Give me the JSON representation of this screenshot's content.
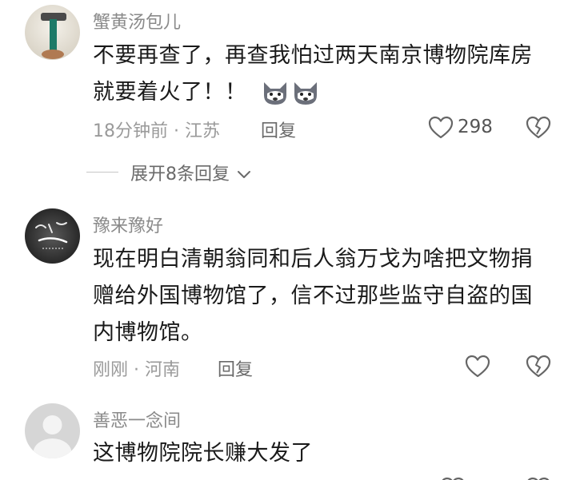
{
  "comments": [
    {
      "username": "蟹黄汤包儿",
      "text_line1": "不要再查了，再查我怕过两天南京博物院库房",
      "text_line2": "就要着火了！！",
      "time_location": "18分钟前 · 江苏",
      "reply_label": "回复",
      "like_count": "298",
      "expand_label": "展开8条回复"
    },
    {
      "username": "豫来豫好",
      "text_line1": "现在明白清朝翁同和后人翁万戈为啥把文物捐",
      "text_line2": "赠给外国博物馆了，信不过那些监守自盗的国",
      "text_line3": "内博物馆。",
      "time_location": "刚刚 · 河南",
      "reply_label": "回复"
    },
    {
      "username": "善恶一念间",
      "text_line1": "这博物院院长赚大发了"
    }
  ],
  "icons": {
    "like": "heart-outline-icon",
    "dislike": "broken-heart-icon",
    "expand": "chevron-down-icon",
    "emoji": "husky-dog-emoji-icon"
  },
  "colors": {
    "username": "#8a8a8a",
    "body": "#1a1a1a",
    "meta": "#9a9a9a"
  }
}
